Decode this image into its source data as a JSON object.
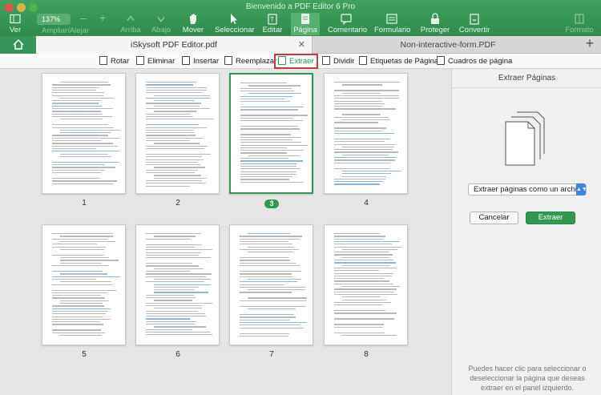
{
  "window": {
    "title": "Bienvenido a PDF Editor 6 Pro"
  },
  "toolbar": {
    "zoom_value": "137%",
    "ver": "Ver",
    "ampliar": "Ampliar/Alejar",
    "arriba": "Arriba",
    "abajo": "Abajo",
    "mover": "Mover",
    "seleccionar": "Seleccionar",
    "editar": "Editar",
    "pagina": "Página",
    "comentario": "Comentario",
    "formulario": "Formulario",
    "proteger": "Proteger",
    "convertir": "Convertir",
    "formato": "Formato"
  },
  "tabs": {
    "tab1": "iSkysoft PDF Editor.pdf",
    "tab2": "Non-interactive-form.PDF"
  },
  "page_toolbar": {
    "rotar": "Rotar",
    "eliminar": "Eliminar",
    "insertar": "Insertar",
    "reemplazar": "Reemplazar",
    "extraer": "Extraer",
    "dividir": "Dividir",
    "etiquetas": "Etiquetas de Página",
    "cuadros": "Cuadros de página"
  },
  "thumbnails": [
    {
      "label": "1"
    },
    {
      "label": "2"
    },
    {
      "label": "3",
      "selected": true
    },
    {
      "label": "4"
    },
    {
      "label": "5"
    },
    {
      "label": "6"
    },
    {
      "label": "7"
    },
    {
      "label": "8"
    }
  ],
  "panel": {
    "title": "Extraer Páginas",
    "select_value": "Extraer páginas como un archivo",
    "cancel": "Cancelar",
    "extract": "Extraer",
    "hint": "Puedes hacer clic para seleccionar o deseleccionar la página que deseas extraer en el panel izquierdo."
  },
  "colors": {
    "accent": "#2f9a54",
    "highlight": "#c73a3a"
  }
}
